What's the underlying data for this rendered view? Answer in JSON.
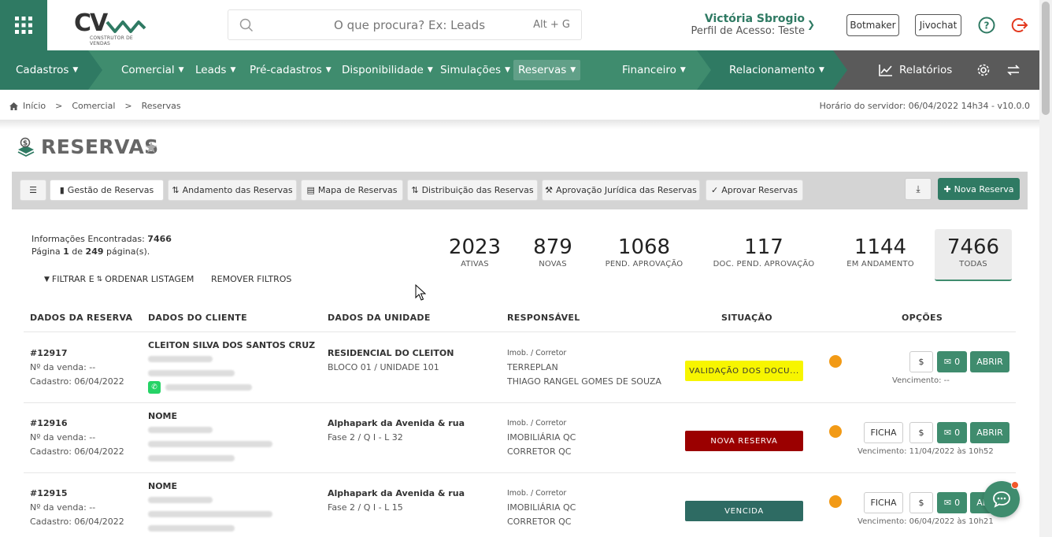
{
  "header": {
    "logo_text": "CV",
    "logo_sub": "CONSTRUTOR DE VENDAS",
    "search_placeholder": "O que procura? Ex: Leads",
    "search_shortcut": "Alt + G",
    "user_name": "Victória Sbrogio",
    "user_profile": "Perfil de Acesso: Teste",
    "btn_botmaker": "Botmaker",
    "btn_jivochat": "Jivochat"
  },
  "nav": {
    "items": [
      "Cadastros",
      "Comercial",
      "Leads",
      "Pré-cadastros",
      "Disponibilidade",
      "Simulações",
      "Reservas",
      "Financeiro",
      "Relacionamento"
    ],
    "reports": "Relatórios",
    "active": "Reservas"
  },
  "breadcrumb": {
    "items": [
      "Início",
      "Comercial",
      "Reservas"
    ]
  },
  "server_time": "Horário do servidor: 06/04/2022 14h34 - v10.0.0",
  "page": {
    "title": "RESERVAS"
  },
  "tabs": {
    "items": [
      "Gestão de Reservas",
      "Andamento das Reservas",
      "Mapa de Reservas",
      "Distribuição das Reservas",
      "Aprovação Jurídica das Reservas",
      "Aprovar Reservas"
    ],
    "new_button": "Nova Reserva"
  },
  "info": {
    "found_label": "Informações Encontradas:",
    "found": "7466",
    "page_prefix": "Página",
    "page": "1",
    "page_of": "de",
    "pages": "249",
    "page_suffix": "página(s).",
    "filter_a": "FILTRAR E",
    "filter_b": "ORDENAR LISTAGEM",
    "remove": "REMOVER FILTROS"
  },
  "stats": [
    {
      "value": "2023",
      "label": "ATIVAS"
    },
    {
      "value": "879",
      "label": "NOVAS"
    },
    {
      "value": "1068",
      "label": "PEND. APROVAÇÃO"
    },
    {
      "value": "117",
      "label": "DOC. PEND. APROVAÇÃO"
    },
    {
      "value": "1144",
      "label": "EM ANDAMENTO"
    },
    {
      "value": "7466",
      "label": "TODAS"
    }
  ],
  "table": {
    "headers": [
      "DADOS DA RESERVA",
      "DADOS DO CLIENTE",
      "DADOS DA UNIDADE",
      "RESPONSÁVEL",
      "SITUAÇÃO",
      "OPÇÕES"
    ],
    "rows": [
      {
        "id": "#12917",
        "venda": "Nº da venda: --",
        "cadastro": "Cadastro: 06/04/2022",
        "cliente": "CLEITON SILVA DOS SANTOS CRUZ",
        "unidade": "RESIDENCIAL DO CLEITON",
        "unidade2": "BLOCO 01 / UNIDADE 101",
        "resp_label": "Imob. / Corretor",
        "resp1": "TERREPLAN",
        "resp2": "THIAGO RANGEL GOMES DE SOUZA",
        "situacao": "VALIDAÇÃO DOS DOCU...",
        "chat_count": "0",
        "open": "ABRIR",
        "ficha": "",
        "vencimento": "Vencimento: --"
      },
      {
        "id": "#12916",
        "venda": "Nº da venda: --",
        "cadastro": "Cadastro: 06/04/2022",
        "cliente": "NOME",
        "unidade": "Alphapark da Avenida & rua",
        "unidade2": "Fase 2 / Q I - L 32",
        "resp_label": "Imob. / Corretor",
        "resp1": "IMOBILIÁRIA QC",
        "resp2": "CORRETOR QC",
        "situacao": "NOVA RESERVA",
        "chat_count": "0",
        "open": "ABRIR",
        "ficha": "FICHA",
        "vencimento": "Vencimento: 11/04/2022 às 10h52"
      },
      {
        "id": "#12915",
        "venda": "Nº da venda: --",
        "cadastro": "Cadastro: 06/04/2022",
        "cliente": "NOME",
        "unidade": "Alphapark da Avenida & rua",
        "unidade2": "Fase 2 / Q I - L 15",
        "resp_label": "Imob. / Corretor",
        "resp1": "IMOBILIÁRIA QC",
        "resp2": "CORRETOR QC",
        "situacao": "VENCIDA",
        "chat_count": "0",
        "open": "ABRIR",
        "ficha": "FICHA",
        "vencimento": "Vencimento: 06/04/2022 às 10h21"
      }
    ]
  },
  "money_symbol": "$",
  "colors": {
    "brand": "#2f7a63",
    "nav": "#3f8c6e",
    "status_yellow": "#f7f500",
    "status_red": "#9b0000",
    "status_teal": "#2e6b63",
    "dot": "#f29a16"
  }
}
